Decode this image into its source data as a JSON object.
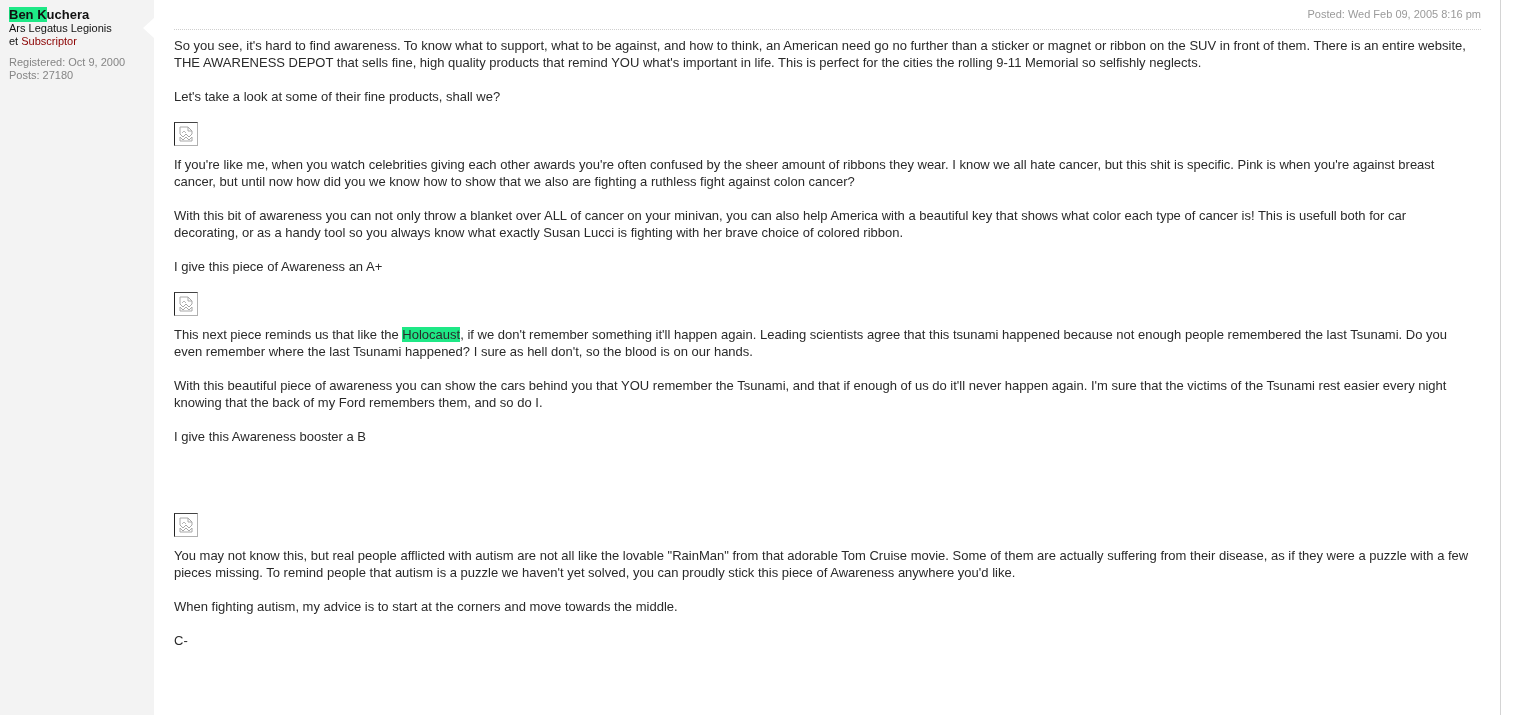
{
  "author": {
    "name_segments": [
      {
        "text": "Ben K",
        "highlighted": true
      },
      {
        "text": "uchera",
        "highlighted": false
      }
    ],
    "rank": "Ars Legatus Legionis et",
    "subscriber_label": "Subscriptor",
    "registered": "Registered: Oct 9, 2000",
    "posts": "Posts: 27180"
  },
  "post": {
    "posted": "Posted: Wed Feb 09, 2005 8:16 pm",
    "blocks": [
      {
        "kind": "text",
        "segments": [
          {
            "text": "So you see, it's hard to find awareness. To know what to support, what to be against, and how to think, an American need go no further than a sticker or magnet or ribbon on the SUV in front of them. There is an entire website, THE AWARENESS DEPOT that sells fine, high quality products that remind YOU what's important in life. This is perfect for the cities the rolling 9-11 Memorial so selfishly neglects.",
            "highlighted": false
          }
        ]
      },
      {
        "kind": "text",
        "segments": [
          {
            "text": "Let's take a look at some of their fine products, shall we?",
            "highlighted": false
          }
        ]
      },
      {
        "kind": "image"
      },
      {
        "kind": "text",
        "segments": [
          {
            "text": "If you're like me, when you watch celebrities giving each other awards you're often confused by the sheer amount of ribbons they wear. I know we all hate cancer, but this shit is specific. Pink is when you're against breast cancer, but until now how did you we know how to show that we also are fighting a ruthless fight against colon cancer?",
            "highlighted": false
          }
        ]
      },
      {
        "kind": "text",
        "segments": [
          {
            "text": "With this bit of awareness you can not only throw a blanket over ALL of cancer on your minivan, you can also help America with a beautiful key that shows what color each type of cancer is! This is usefull both for car decorating, or as a handy tool so you always know what exactly Susan Lucci is fighting with her brave choice of colored ribbon.",
            "highlighted": false
          }
        ]
      },
      {
        "kind": "text",
        "segments": [
          {
            "text": "I give this piece of Awareness an A+",
            "highlighted": false
          }
        ]
      },
      {
        "kind": "image"
      },
      {
        "kind": "text",
        "segments": [
          {
            "text": "This next piece reminds us that like the ",
            "highlighted": false
          },
          {
            "text": "Holocaust",
            "highlighted": true
          },
          {
            "text": ", if we don't remember something it'll happen again. Leading scientists agree that this tsunami happened because not enough people remembered the last Tsunami. Do you even remember where the last Tsunami happened? I sure as hell don't, so the blood is on our hands.",
            "highlighted": false
          }
        ]
      },
      {
        "kind": "text",
        "segments": [
          {
            "text": "With this beautiful piece of awareness you can show the cars behind you that YOU remember the Tsunami, and that if enough of us do it'll never happen again. I'm sure that the victims of the Tsunami rest easier every night knowing that the back of my Ford remembers them, and so do I.",
            "highlighted": false
          }
        ]
      },
      {
        "kind": "text",
        "segments": [
          {
            "text": "I give this Awareness booster a B",
            "highlighted": false
          }
        ]
      },
      {
        "kind": "break"
      },
      {
        "kind": "break"
      },
      {
        "kind": "break"
      },
      {
        "kind": "image"
      },
      {
        "kind": "text",
        "segments": [
          {
            "text": "You may not know this, but real people afflicted with autism are not all like the lovable \"RainMan\" from that adorable Tom Cruise movie. Some of them are actually suffering from their disease, as if they were a puzzle with a few pieces missing. To remind people that autism is a puzzle we haven't yet solved, you can proudly stick this piece of Awareness anywhere you'd like.",
            "highlighted": false
          }
        ]
      },
      {
        "kind": "text",
        "segments": [
          {
            "text": "When fighting autism, my advice is to start at the corners and move towards the middle.",
            "highlighted": false
          }
        ]
      },
      {
        "kind": "text",
        "segments": [
          {
            "text": "C-",
            "highlighted": false
          }
        ]
      }
    ]
  }
}
